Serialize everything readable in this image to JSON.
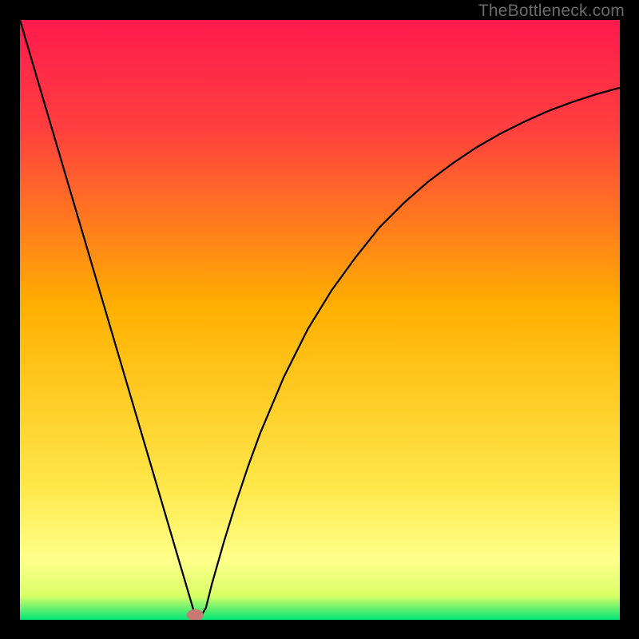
{
  "watermark": "TheBottleneck.com",
  "chart_data": {
    "type": "line",
    "title": "",
    "xlabel": "",
    "ylabel": "",
    "xlim": [
      0,
      100
    ],
    "ylim": [
      0,
      100
    ],
    "grid": false,
    "legend": false,
    "background_gradient": {
      "top_color": "#ff1a4d",
      "mid_color": "#ffc200",
      "lower_color": "#ffff66",
      "bottom_color": "#00e676"
    },
    "series": [
      {
        "name": "curve",
        "stroke": "#000000",
        "stroke_width": 2,
        "x": [
          0,
          2,
          4,
          6,
          8,
          10,
          12,
          14,
          16,
          18,
          20,
          22,
          24,
          26,
          28,
          29,
          30,
          31,
          32,
          34,
          36,
          38,
          40,
          44,
          48,
          52,
          56,
          60,
          64,
          68,
          72,
          76,
          80,
          84,
          88,
          92,
          96,
          100
        ],
        "y": [
          100,
          93.2,
          86.4,
          79.6,
          72.8,
          66.0,
          59.2,
          52.4,
          45.6,
          38.8,
          32.0,
          25.2,
          18.4,
          11.6,
          4.8,
          1.4,
          0.3,
          2.0,
          6.0,
          13.0,
          19.5,
          25.5,
          31.0,
          40.5,
          48.5,
          55.0,
          60.5,
          65.5,
          69.5,
          73.0,
          76.0,
          78.7,
          81.0,
          83.0,
          84.8,
          86.3,
          87.6,
          88.7
        ]
      }
    ],
    "marker": {
      "x": 29.2,
      "y": 0.8,
      "rx": 1.4,
      "ry": 0.95,
      "fill": "#c77a74"
    }
  }
}
